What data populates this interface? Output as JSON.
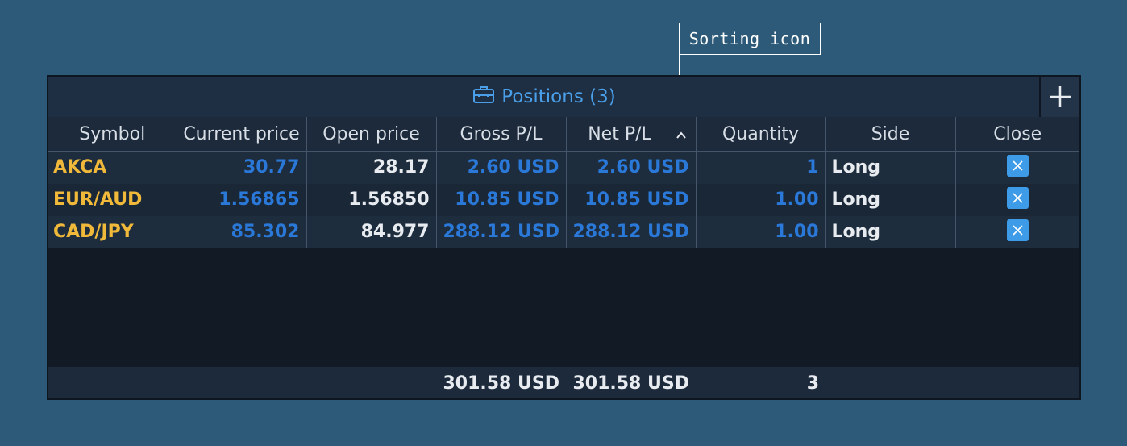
{
  "annotation": {
    "label": "Sorting icon"
  },
  "panel": {
    "title": "Positions (3)",
    "icons": {
      "title": "briefcase-icon",
      "add": "plus-icon",
      "sort": "chevron-up-icon",
      "close": "close-x-icon"
    }
  },
  "columns": [
    "Symbol",
    "Current price",
    "Open price",
    "Gross P/L",
    "Net P/L",
    "Quantity",
    "Side",
    "Close"
  ],
  "rows": [
    {
      "symbol": "AKCA",
      "current": "30.77",
      "open": "28.17",
      "gross": "2.60 USD",
      "net": "2.60 USD",
      "quantity": "1",
      "side": "Long"
    },
    {
      "symbol": "EUR/AUD",
      "current": "1.56865",
      "open": "1.56850",
      "gross": "10.85 USD",
      "net": "10.85 USD",
      "quantity": "1.00",
      "side": "Long"
    },
    {
      "symbol": "CAD/JPY",
      "current": "85.302",
      "open": "84.977",
      "gross": "288.12 USD",
      "net": "288.12 USD",
      "quantity": "1.00",
      "side": "Long"
    }
  ],
  "totals": {
    "gross": "301.58 USD",
    "net": "301.58 USD",
    "quantity": "3"
  },
  "colors": {
    "background": "#2d5a78",
    "symbol": "#f0b93a",
    "value_blue": "#2a78d8",
    "title_blue": "#4a9fe8",
    "close_button": "#3e9be8"
  }
}
